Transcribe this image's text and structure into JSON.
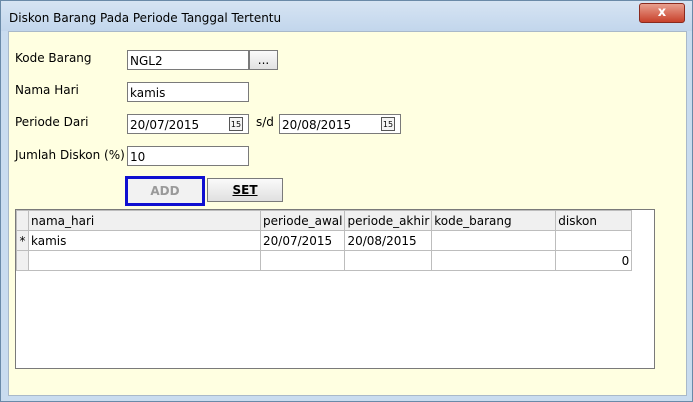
{
  "window": {
    "title": "Diskon Barang Pada Periode Tanggal Tertentu",
    "close_label": "x"
  },
  "form": {
    "kode_barang_label": "Kode Barang",
    "kode_barang_value": "NGL2",
    "browse_label": "...",
    "nama_hari_label": "Nama Hari",
    "nama_hari_value": "kamis",
    "periode_dari_label": "Periode Dari",
    "periode_from_value": "20/07/2015",
    "sd_label": "s/d",
    "periode_to_value": "20/08/2015",
    "jumlah_diskon_label": "Jumlah Diskon (%)",
    "jumlah_diskon_value": "10",
    "calendar_icon_text": "15"
  },
  "buttons": {
    "add_label": "ADD",
    "set_label": "SET"
  },
  "grid": {
    "columns": [
      "nama_hari",
      "periode_awal",
      "periode_akhir",
      "kode_barang",
      "diskon"
    ],
    "rows": [
      {
        "marker": "*",
        "nama_hari": "kamis",
        "periode_awal": "20/07/2015",
        "periode_akhir": "20/08/2015",
        "kode_barang": "",
        "diskon": ""
      },
      {
        "marker": "",
        "nama_hari": "",
        "periode_awal": "",
        "periode_akhir": "",
        "kode_barang": "",
        "diskon": "0"
      }
    ]
  },
  "colors": {
    "client_bg": "#ffffe1",
    "focus_border": "#1010d0"
  }
}
